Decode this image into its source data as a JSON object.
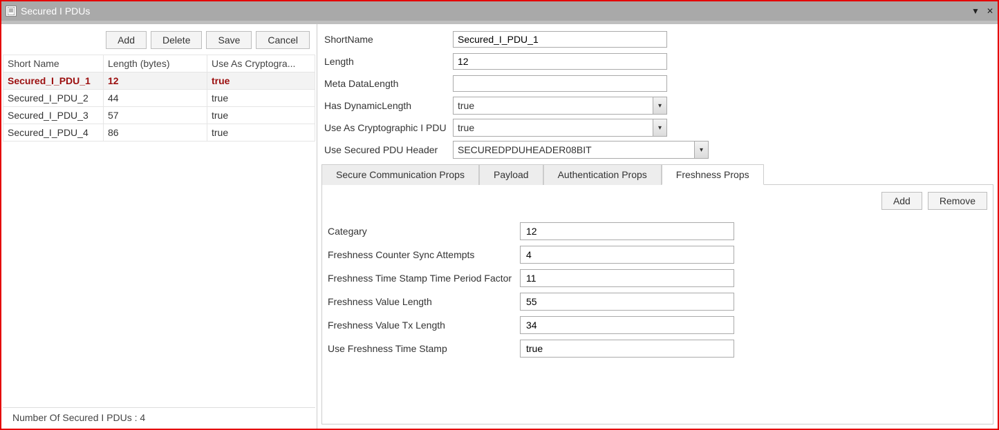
{
  "window": {
    "title": "Secured I PDUs"
  },
  "left": {
    "buttons": {
      "add": "Add",
      "delete": "Delete",
      "save": "Save",
      "cancel": "Cancel"
    },
    "columns": {
      "short_name": "Short Name",
      "length": "Length (bytes)",
      "use_cryp": "Use As Cryptogra..."
    },
    "rows": [
      {
        "short_name": "Secured_I_PDU_1",
        "length": "12",
        "use_cryp": "true",
        "selected": true
      },
      {
        "short_name": "Secured_I_PDU_2",
        "length": "44",
        "use_cryp": "true",
        "selected": false
      },
      {
        "short_name": "Secured_I_PDU_3",
        "length": "57",
        "use_cryp": "true",
        "selected": false
      },
      {
        "short_name": "Secured_I_PDU_4",
        "length": "86",
        "use_cryp": "true",
        "selected": false
      }
    ],
    "status": "Number Of Secured I PDUs : 4"
  },
  "form": {
    "shortname_label": "ShortName",
    "shortname_value": "Secured_I_PDU_1",
    "length_label": "Length",
    "length_value": "12",
    "meta_label": "Meta DataLength",
    "meta_value": "",
    "has_dyn_label": "Has DynamicLength",
    "has_dyn_value": "true",
    "use_cryp_label": "Use As Cryptographic I PDU",
    "use_cryp_value": "true",
    "use_sec_hdr_label": "Use Secured PDU Header",
    "use_sec_hdr_value": "SECUREDPDUHEADER08BIT"
  },
  "tabs": {
    "t0": "Secure Communication Props",
    "t1": "Payload",
    "t2": "Authentication Props",
    "t3": "Freshness Props",
    "add": "Add",
    "remove": "Remove"
  },
  "freshness": {
    "category_label": "Categary",
    "category_value": "12",
    "sync_label": "Freshness Counter Sync Attempts",
    "sync_value": "4",
    "tpf_label": "Freshness Time Stamp Time Period Factor",
    "tpf_value": "11",
    "fvl_label": "Freshness Value Length",
    "fvl_value": "55",
    "fvtxl_label": "Freshness Value Tx Length",
    "fvtxl_value": "34",
    "ufts_label": "Use Freshness Time Stamp",
    "ufts_value": "true"
  }
}
